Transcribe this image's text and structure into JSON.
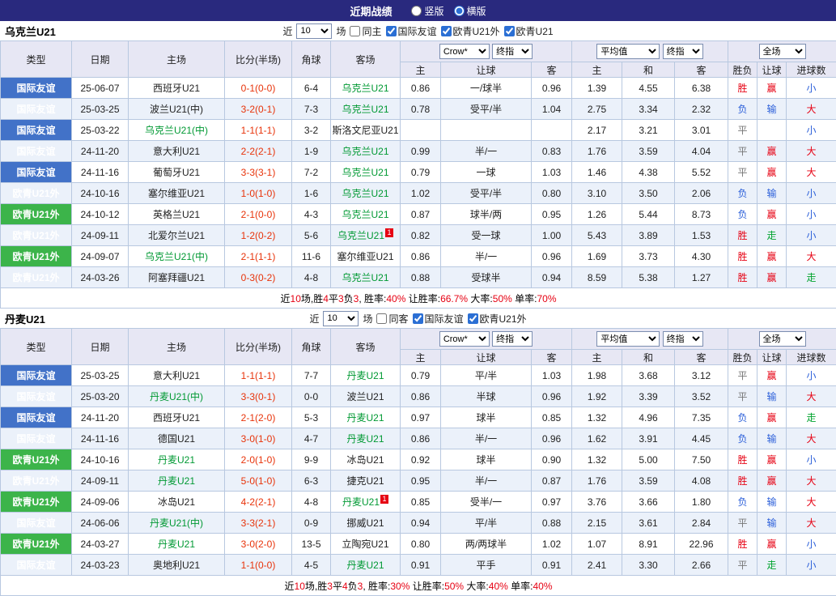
{
  "topbar": {
    "title": "近期战绩",
    "radios": [
      {
        "label": "竖版",
        "selected": false
      },
      {
        "label": "横版",
        "selected": true
      }
    ]
  },
  "table_head": {
    "main_cols": [
      "类型",
      "日期",
      "主场",
      "比分(半场)",
      "角球",
      "客场"
    ],
    "odds_dropdowns": [
      "Crow*",
      "终指"
    ],
    "odds_cols": [
      "主",
      "让球",
      "客"
    ],
    "avg_dropdowns": [
      "平均值",
      "终指"
    ],
    "avg_cols": [
      "主",
      "和",
      "客"
    ],
    "scope_dropdown": "全场",
    "result_cols": [
      "胜负",
      "让球",
      "进球数"
    ]
  },
  "sections": [
    {
      "team": "乌克兰U21",
      "filters": {
        "prefix": "近",
        "count": "10",
        "suffix": "场",
        "checkboxes": [
          {
            "label": "同主",
            "checked": false
          },
          {
            "label": "国际友谊",
            "checked": true
          },
          {
            "label": "欧青U21外",
            "checked": true
          },
          {
            "label": "欧青U21",
            "checked": true
          }
        ]
      },
      "rows": [
        {
          "lg": "国际友谊",
          "dt": "25-06-07",
          "hm": "西班牙U21",
          "sc": "0-1(0-0)",
          "cn": "6-4",
          "aw": "乌克兰U21",
          "o1": "0.86",
          "hd": "一/球半",
          "o2": "0.96",
          "a1": "1.39",
          "a2": "4.55",
          "a3": "6.38",
          "r1": "胜",
          "r2": "赢",
          "r3": "小"
        },
        {
          "lg": "国际友谊",
          "dt": "25-03-25",
          "hm": "波兰U21(中)",
          "sc": "3-2(0-1)",
          "cn": "7-3",
          "aw": "乌克兰U21",
          "o1": "0.78",
          "hd": "受平/半",
          "o2": "1.04",
          "a1": "2.75",
          "a2": "3.34",
          "a3": "2.32",
          "r1": "负",
          "r2": "输",
          "r3": "大"
        },
        {
          "lg": "国际友谊",
          "dt": "25-03-22",
          "hm": "乌克兰U21(中)",
          "sc": "1-1(1-1)",
          "cn": "3-2",
          "aw": "斯洛文尼亚U21",
          "o1": "",
          "hd": "",
          "o2": "",
          "a1": "2.17",
          "a2": "3.21",
          "a3": "3.01",
          "r1": "平",
          "r2": "",
          "r3": "小"
        },
        {
          "lg": "国际友谊",
          "dt": "24-11-20",
          "hm": "意大利U21",
          "sc": "2-2(2-1)",
          "cn": "1-9",
          "aw": "乌克兰U21",
          "o1": "0.99",
          "hd": "半/一",
          "o2": "0.83",
          "a1": "1.76",
          "a2": "3.59",
          "a3": "4.04",
          "r1": "平",
          "r2": "赢",
          "r3": "大"
        },
        {
          "lg": "国际友谊",
          "dt": "24-11-16",
          "hm": "葡萄牙U21",
          "sc": "3-3(3-1)",
          "cn": "7-2",
          "aw": "乌克兰U21",
          "o1": "0.79",
          "hd": "一球",
          "o2": "1.03",
          "a1": "1.46",
          "a2": "4.38",
          "a3": "5.52",
          "r1": "平",
          "r2": "赢",
          "r3": "大"
        },
        {
          "lg": "欧青U21外",
          "dt": "24-10-16",
          "hm": "塞尔维亚U21",
          "sc": "1-0(1-0)",
          "cn": "1-6",
          "aw": "乌克兰U21",
          "o1": "1.02",
          "hd": "受平/半",
          "o2": "0.80",
          "a1": "3.10",
          "a2": "3.50",
          "a3": "2.06",
          "r1": "负",
          "r2": "输",
          "r3": "小"
        },
        {
          "lg": "欧青U21外",
          "dt": "24-10-12",
          "hm": "英格兰U21",
          "sc": "2-1(0-0)",
          "cn": "4-3",
          "aw": "乌克兰U21",
          "o1": "0.87",
          "hd": "球半/两",
          "o2": "0.95",
          "a1": "1.26",
          "a2": "5.44",
          "a3": "8.73",
          "r1": "负",
          "r2": "赢",
          "r3": "小"
        },
        {
          "lg": "欧青U21外",
          "dt": "24-09-11",
          "hm": "北爱尔兰U21",
          "sc": "1-2(0-2)",
          "cn": "5-6",
          "aw": "乌克兰U21",
          "ab": "1",
          "o1": "0.82",
          "hd": "受一球",
          "o2": "1.00",
          "a1": "5.43",
          "a2": "3.89",
          "a3": "1.53",
          "r1": "胜",
          "r2": "走",
          "r3": "小"
        },
        {
          "lg": "欧青U21外",
          "dt": "24-09-07",
          "hm": "乌克兰U21(中)",
          "sc": "2-1(1-1)",
          "cn": "11-6",
          "aw": "塞尔维亚U21",
          "o1": "0.86",
          "hd": "半/一",
          "o2": "0.96",
          "a1": "1.69",
          "a2": "3.73",
          "a3": "4.30",
          "r1": "胜",
          "r2": "赢",
          "r3": "大"
        },
        {
          "lg": "欧青U21外",
          "dt": "24-03-26",
          "hm": "阿塞拜疆U21",
          "sc": "0-3(0-2)",
          "cn": "4-8",
          "aw": "乌克兰U21",
          "o1": "0.88",
          "hd": "受球半",
          "o2": "0.94",
          "a1": "8.59",
          "a2": "5.38",
          "a3": "1.27",
          "r1": "胜",
          "r2": "赢",
          "r3": "走"
        }
      ],
      "summary": [
        {
          "t": "近"
        },
        {
          "t": "10",
          "r": 1
        },
        {
          "t": "场,胜"
        },
        {
          "t": "4",
          "r": 1
        },
        {
          "t": "平"
        },
        {
          "t": "3",
          "r": 1
        },
        {
          "t": "负"
        },
        {
          "t": "3",
          "r": 1
        },
        {
          "t": ", 胜率:"
        },
        {
          "t": "40%",
          "r": 1
        },
        {
          "t": " 让胜率:"
        },
        {
          "t": "66.7%",
          "r": 1
        },
        {
          "t": " 大率:"
        },
        {
          "t": "50%",
          "r": 1
        },
        {
          "t": " 单率:"
        },
        {
          "t": "70%",
          "r": 1
        }
      ]
    },
    {
      "team": "丹麦U21",
      "filters": {
        "prefix": "近",
        "count": "10",
        "suffix": "场",
        "checkboxes": [
          {
            "label": "同客",
            "checked": false
          },
          {
            "label": "国际友谊",
            "checked": true
          },
          {
            "label": "欧青U21外",
            "checked": true
          }
        ]
      },
      "rows": [
        {
          "lg": "国际友谊",
          "dt": "25-03-25",
          "hm": "意大利U21",
          "sc": "1-1(1-1)",
          "cn": "7-7",
          "aw": "丹麦U21",
          "o1": "0.79",
          "hd": "平/半",
          "o2": "1.03",
          "a1": "1.98",
          "a2": "3.68",
          "a3": "3.12",
          "r1": "平",
          "r2": "赢",
          "r3": "小"
        },
        {
          "lg": "国际友谊",
          "dt": "25-03-20",
          "hm": "丹麦U21(中)",
          "sc": "3-3(0-1)",
          "cn": "0-0",
          "aw": "波兰U21",
          "o1": "0.86",
          "hd": "半球",
          "o2": "0.96",
          "a1": "1.92",
          "a2": "3.39",
          "a3": "3.52",
          "r1": "平",
          "r2": "输",
          "r3": "大"
        },
        {
          "lg": "国际友谊",
          "dt": "24-11-20",
          "hm": "西班牙U21",
          "sc": "2-1(2-0)",
          "cn": "5-3",
          "aw": "丹麦U21",
          "o1": "0.97",
          "hd": "球半",
          "o2": "0.85",
          "a1": "1.32",
          "a2": "4.96",
          "a3": "7.35",
          "r1": "负",
          "r2": "赢",
          "r3": "走"
        },
        {
          "lg": "国际友谊",
          "dt": "24-11-16",
          "hm": "德国U21",
          "sc": "3-0(1-0)",
          "cn": "4-7",
          "aw": "丹麦U21",
          "o1": "0.86",
          "hd": "半/一",
          "o2": "0.96",
          "a1": "1.62",
          "a2": "3.91",
          "a3": "4.45",
          "r1": "负",
          "r2": "输",
          "r3": "大"
        },
        {
          "lg": "欧青U21外",
          "dt": "24-10-16",
          "hm": "丹麦U21",
          "sc": "2-0(1-0)",
          "cn": "9-9",
          "aw": "冰岛U21",
          "o1": "0.92",
          "hd": "球半",
          "o2": "0.90",
          "a1": "1.32",
          "a2": "5.00",
          "a3": "7.50",
          "r1": "胜",
          "r2": "赢",
          "r3": "小"
        },
        {
          "lg": "欧青U21外",
          "dt": "24-09-11",
          "hm": "丹麦U21",
          "sc": "5-0(1-0)",
          "cn": "6-3",
          "aw": "捷克U21",
          "o1": "0.95",
          "hd": "半/一",
          "o2": "0.87",
          "a1": "1.76",
          "a2": "3.59",
          "a3": "4.08",
          "r1": "胜",
          "r2": "赢",
          "r3": "大"
        },
        {
          "lg": "欧青U21外",
          "dt": "24-09-06",
          "hm": "冰岛U21",
          "sc": "4-2(2-1)",
          "cn": "4-8",
          "aw": "丹麦U21",
          "ab": "1",
          "o1": "0.85",
          "hd": "受半/一",
          "o2": "0.97",
          "a1": "3.76",
          "a2": "3.66",
          "a3": "1.80",
          "r1": "负",
          "r2": "输",
          "r3": "大"
        },
        {
          "lg": "国际友谊",
          "dt": "24-06-06",
          "hm": "丹麦U21(中)",
          "sc": "3-3(2-1)",
          "cn": "0-9",
          "aw": "挪威U21",
          "o1": "0.94",
          "hd": "平/半",
          "o2": "0.88",
          "a1": "2.15",
          "a2": "3.61",
          "a3": "2.84",
          "r1": "平",
          "r2": "输",
          "r3": "大"
        },
        {
          "lg": "欧青U21外",
          "dt": "24-03-27",
          "hm": "丹麦U21",
          "sc": "3-0(2-0)",
          "cn": "13-5",
          "aw": "立陶宛U21",
          "o1": "0.80",
          "hd": "两/两球半",
          "o2": "1.02",
          "a1": "1.07",
          "a2": "8.91",
          "a3": "22.96",
          "r1": "胜",
          "r2": "赢",
          "r3": "小"
        },
        {
          "lg": "国际友谊",
          "dt": "24-03-23",
          "hm": "奥地利U21",
          "sc": "1-1(0-0)",
          "cn": "4-5",
          "aw": "丹麦U21",
          "o1": "0.91",
          "hd": "平手",
          "o2": "0.91",
          "a1": "2.41",
          "a2": "3.30",
          "a3": "2.66",
          "r1": "平",
          "r2": "走",
          "r3": "小"
        }
      ],
      "summary": [
        {
          "t": "近"
        },
        {
          "t": "10",
          "r": 1
        },
        {
          "t": "场,胜"
        },
        {
          "t": "3",
          "r": 1
        },
        {
          "t": "平"
        },
        {
          "t": "4",
          "r": 1
        },
        {
          "t": "负"
        },
        {
          "t": "3",
          "r": 1
        },
        {
          "t": ", 胜率:"
        },
        {
          "t": "30%",
          "r": 1
        },
        {
          "t": " 让胜率:"
        },
        {
          "t": "50%",
          "r": 1
        },
        {
          "t": " 大率:"
        },
        {
          "t": "40%",
          "r": 1
        },
        {
          "t": " 单率:"
        },
        {
          "t": "40%",
          "r": 1
        }
      ]
    }
  ]
}
